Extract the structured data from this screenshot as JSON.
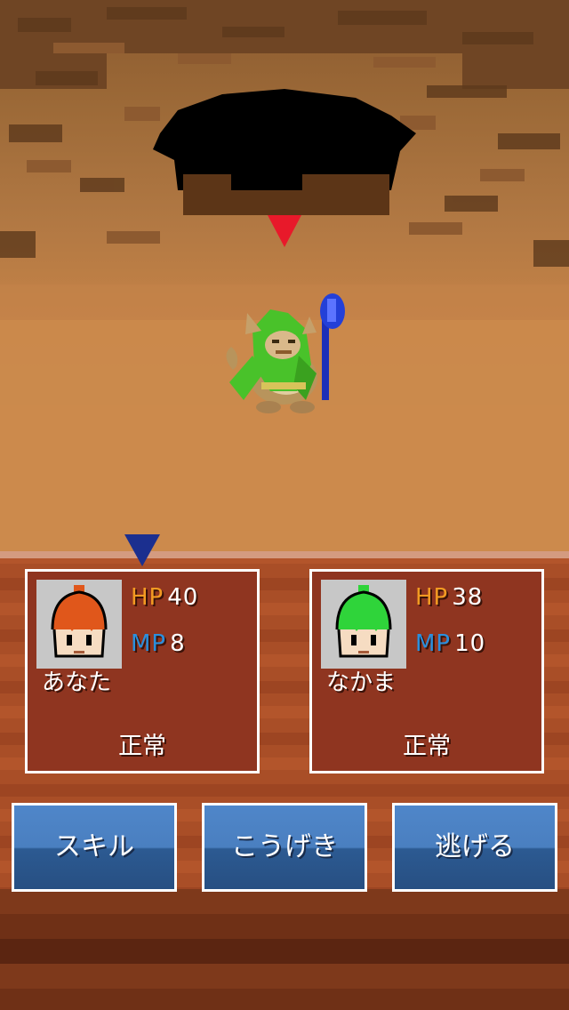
{
  "scene": {
    "enemy_icon": "cat-wizard-monster-icon",
    "target_cursor_color": "#e8192a",
    "active_cursor_color": "#1b2f8f"
  },
  "party": [
    {
      "name": "あなた",
      "hp_label": "HP",
      "hp": "40",
      "mp_label": "MP",
      "mp": "8",
      "status": "正常",
      "hair_color": "#e0571b",
      "portrait_icon": "red-hair-hero-icon"
    },
    {
      "name": "なかま",
      "hp_label": "HP",
      "hp": "38",
      "mp_label": "MP",
      "mp": "10",
      "status": "正常",
      "hair_color": "#2fd43a",
      "portrait_icon": "green-hair-hero-icon"
    }
  ],
  "commands": {
    "skill": "スキル",
    "attack": "こうげき",
    "flee": "逃げる"
  },
  "colors": {
    "hp_label": "#f29a22",
    "mp_label": "#2a8fdd",
    "button_blue": "#4a7fc0",
    "card_bg": "#8f3520"
  }
}
